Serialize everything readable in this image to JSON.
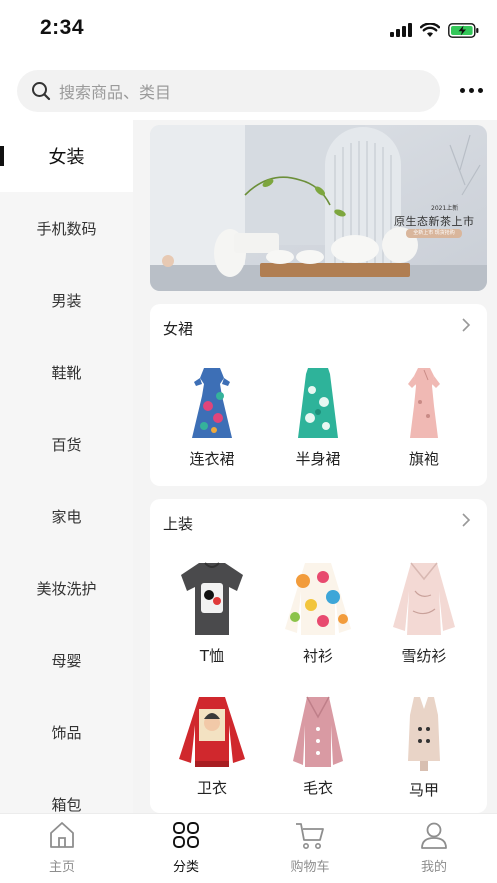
{
  "status_bar": {
    "time": "2:34",
    "icons": [
      "signal-icon",
      "wifi-icon",
      "battery-charging-icon"
    ]
  },
  "search": {
    "placeholder": "搜索商品、类目",
    "icon": "search-icon",
    "more_icon": "more-dots-icon"
  },
  "sidebar": {
    "items": [
      {
        "label": "女装",
        "active": true
      },
      {
        "label": "手机数码",
        "active": false
      },
      {
        "label": "男装",
        "active": false
      },
      {
        "label": "鞋靴",
        "active": false
      },
      {
        "label": "百货",
        "active": false
      },
      {
        "label": "家电",
        "active": false
      },
      {
        "label": "美妆洗护",
        "active": false
      },
      {
        "label": "母婴",
        "active": false
      },
      {
        "label": "饰品",
        "active": false
      },
      {
        "label": "箱包",
        "active": false
      }
    ]
  },
  "banner": {
    "year": "2021上新",
    "title": "原生态新茶上市",
    "tag": "全新上市 现货抢购"
  },
  "sections": [
    {
      "title": "女裙",
      "items": [
        {
          "label": "连衣裙",
          "icon": "dress-image"
        },
        {
          "label": "半身裙",
          "icon": "skirt-image"
        },
        {
          "label": "旗袍",
          "icon": "qipao-image"
        }
      ]
    },
    {
      "title": "上装",
      "items": [
        {
          "label": "T恤",
          "icon": "tshirt-image"
        },
        {
          "label": "衬衫",
          "icon": "shirt-image"
        },
        {
          "label": "雪纺衫",
          "icon": "chiffon-blouse-image"
        },
        {
          "label": "卫衣",
          "icon": "sweatshirt-image"
        },
        {
          "label": "毛衣",
          "icon": "sweater-image"
        },
        {
          "label": "马甲",
          "icon": "vest-image"
        }
      ]
    }
  ],
  "tabbar": {
    "items": [
      {
        "label": "主页",
        "icon": "home-icon",
        "active": false
      },
      {
        "label": "分类",
        "icon": "category-icon",
        "active": true
      },
      {
        "label": "购物车",
        "icon": "cart-icon",
        "active": false
      },
      {
        "label": "我的",
        "icon": "profile-icon",
        "active": false
      }
    ]
  },
  "colors": {
    "active_text": "#111111",
    "inactive_text": "#8e8e8e",
    "sidebar_bg": "#f6f6f6",
    "content_bg": "#f4f4f4",
    "battery_green": "#34c759"
  }
}
